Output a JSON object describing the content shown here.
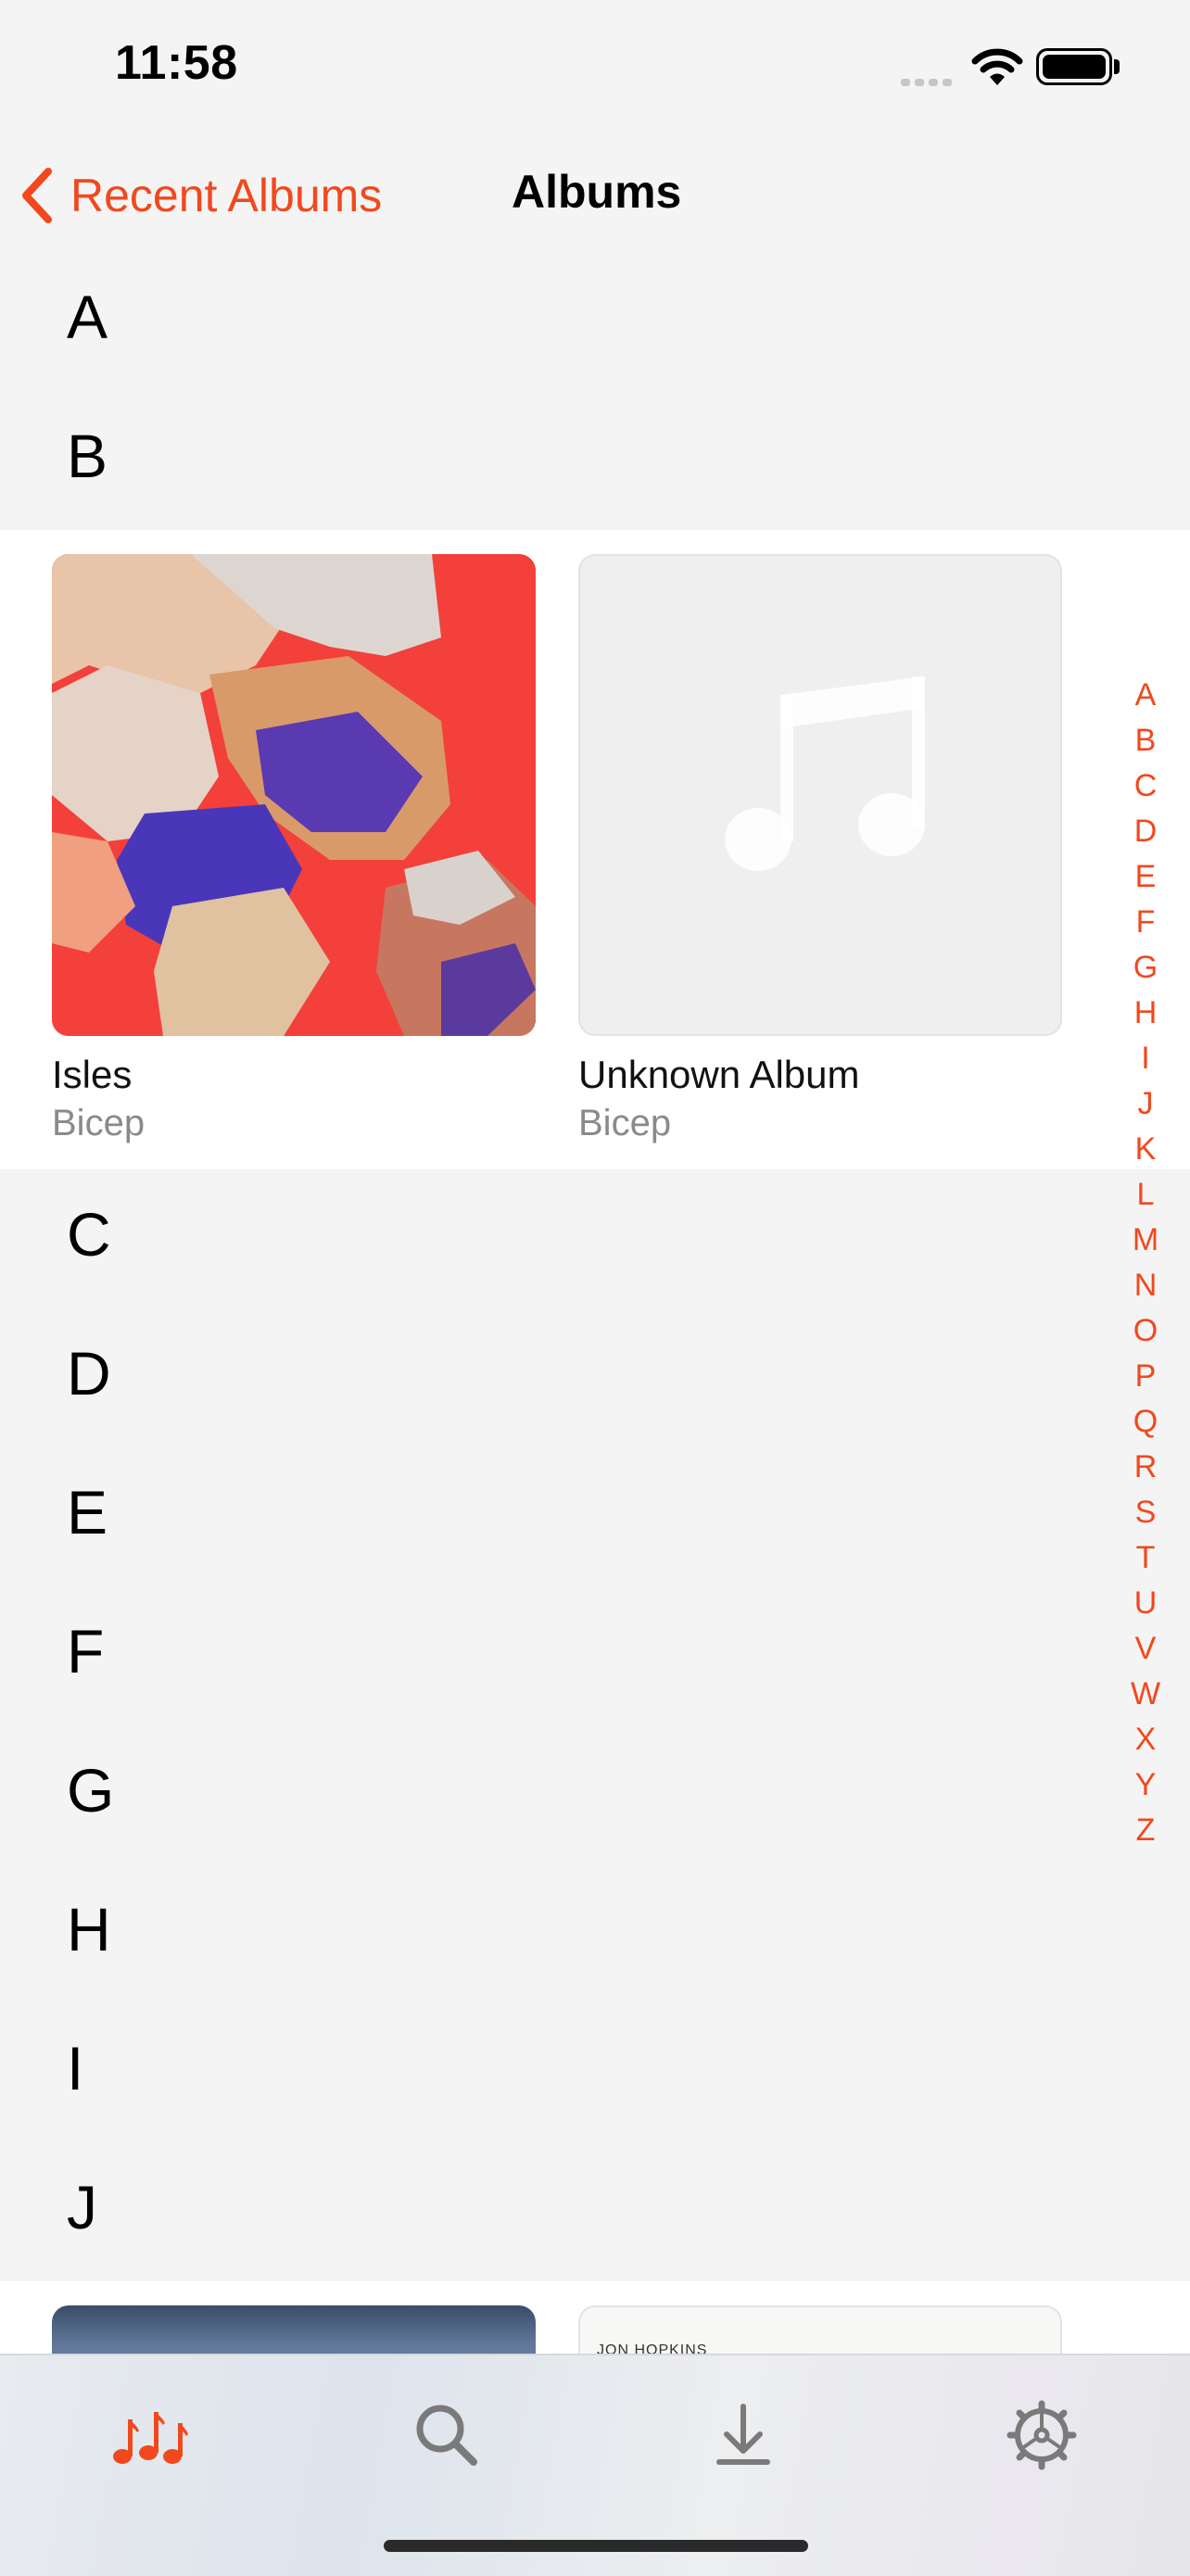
{
  "status_bar": {
    "time": "11:58"
  },
  "nav": {
    "back_label": "Recent Albums",
    "title": "Albums"
  },
  "sections": {
    "a": "A",
    "b": "B",
    "c": "C",
    "d": "D",
    "e": "E",
    "f": "F",
    "g": "G",
    "h": "H",
    "i": "I",
    "j": "J"
  },
  "albums_b": [
    {
      "name": "Isles",
      "artist": "Bicep"
    },
    {
      "name": "Unknown Album",
      "artist": "Bicep"
    }
  ],
  "albums_j": [
    {
      "cover_text": "JON HOPKINS"
    }
  ],
  "index_letters": [
    "A",
    "B",
    "C",
    "D",
    "E",
    "F",
    "G",
    "H",
    "I",
    "J",
    "K",
    "L",
    "M",
    "N",
    "O",
    "P",
    "Q",
    "R",
    "S",
    "T",
    "U",
    "V",
    "W",
    "X",
    "Y",
    "Z"
  ],
  "tabs": [
    {
      "icon": "music-notes-icon",
      "active": true
    },
    {
      "icon": "search-icon",
      "active": false
    },
    {
      "icon": "download-icon",
      "active": false
    },
    {
      "icon": "settings-icon",
      "active": false
    }
  ],
  "colors": {
    "accent": "#f2481d",
    "background": "#f4f4f4",
    "card_background": "#ffffff",
    "secondary_text": "#8a8a8a"
  }
}
